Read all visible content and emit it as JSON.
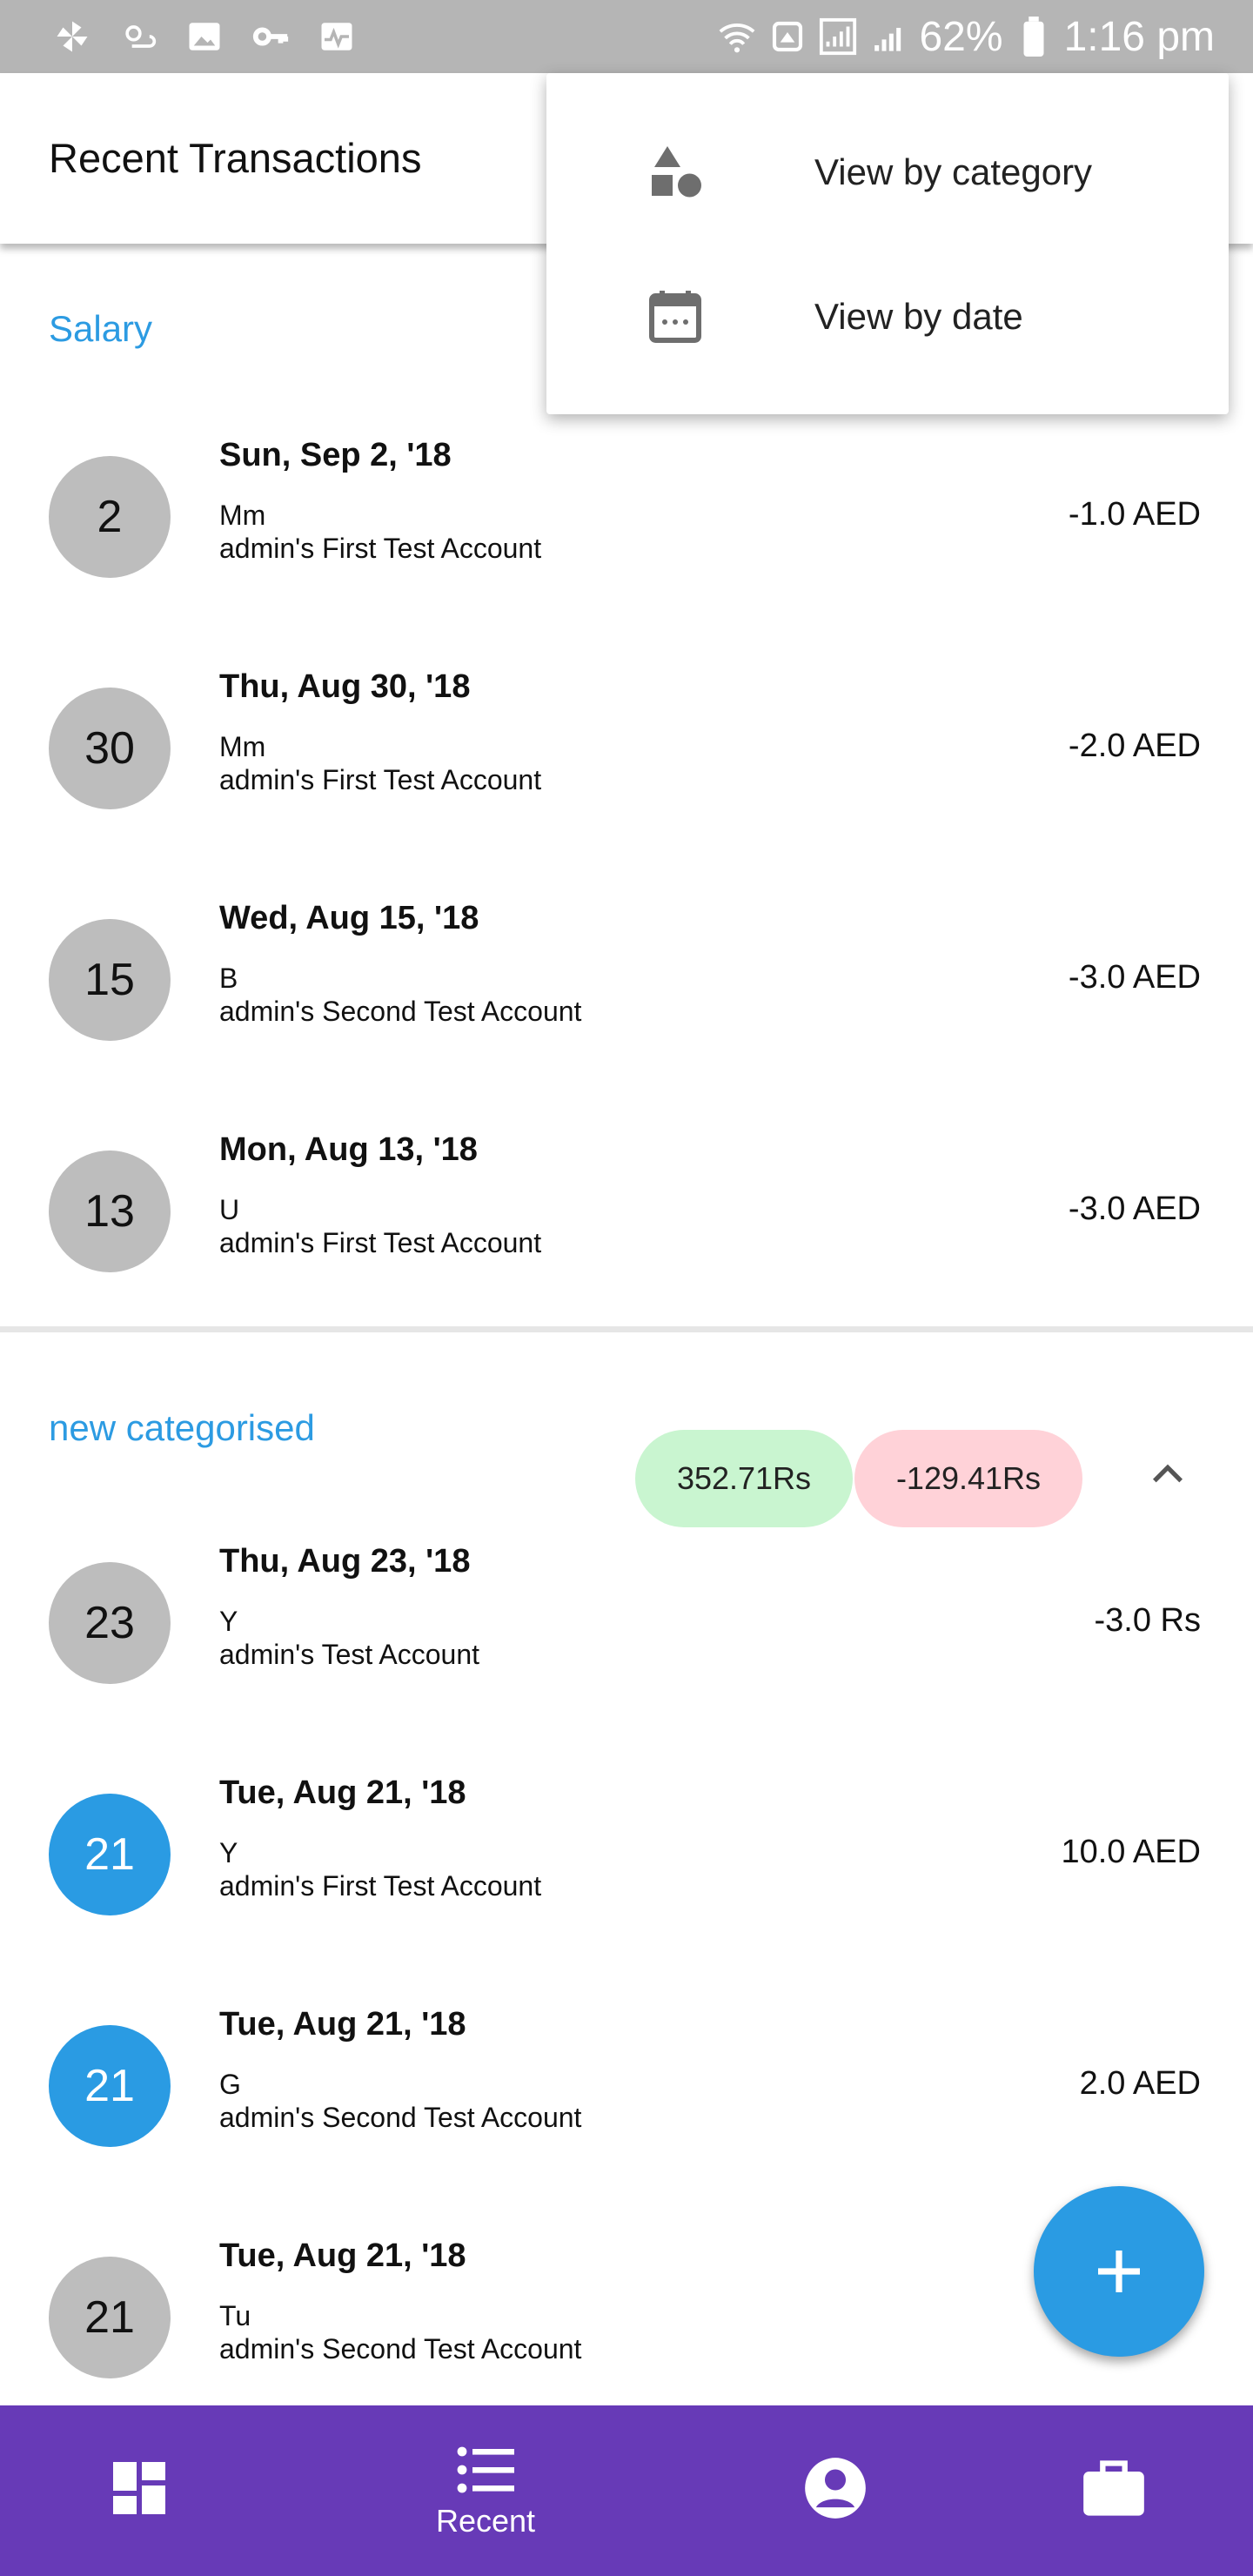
{
  "status_bar": {
    "battery": "62%",
    "time": "1:16 pm"
  },
  "app_bar": {
    "title": "Recent Transactions"
  },
  "menu": {
    "items": [
      {
        "label": "View by category",
        "icon": "category-shapes-icon"
      },
      {
        "label": "View by date",
        "icon": "calendar-icon"
      }
    ]
  },
  "groups": [
    {
      "title": "Salary",
      "transactions": [
        {
          "day": "2",
          "date": "Sun, Sep 2, '18",
          "desc": "Mm",
          "account": "admin's First Test Account",
          "amount": "-1.0 AED",
          "highlight": false
        },
        {
          "day": "30",
          "date": "Thu, Aug 30, '18",
          "desc": "Mm",
          "account": "admin's First Test Account",
          "amount": "-2.0 AED",
          "highlight": false
        },
        {
          "day": "15",
          "date": "Wed, Aug 15, '18",
          "desc": "B",
          "account": "admin's Second Test Account",
          "amount": "-3.0 AED",
          "highlight": false
        },
        {
          "day": "13",
          "date": "Mon, Aug 13, '18",
          "desc": "U",
          "account": "admin's First Test Account",
          "amount": "-3.0 AED",
          "highlight": false
        }
      ]
    },
    {
      "title": "new categorised",
      "income": "352.71Rs",
      "expense": "-129.41Rs",
      "transactions": [
        {
          "day": "23",
          "date": "Thu, Aug 23, '18",
          "desc": "Y",
          "account": "admin's Test Account",
          "amount": "-3.0 Rs",
          "highlight": false
        },
        {
          "day": "21",
          "date": "Tue, Aug 21, '18",
          "desc": "Y",
          "account": "admin's First Test Account",
          "amount": "10.0 AED",
          "highlight": true
        },
        {
          "day": "21",
          "date": "Tue, Aug 21, '18",
          "desc": "G",
          "account": "admin's Second Test Account",
          "amount": "2.0 AED",
          "highlight": true
        },
        {
          "day": "21",
          "date": "Tue, Aug 21, '18",
          "desc": "Tu",
          "account": "admin's Second Test Account",
          "amount": "",
          "highlight": false
        }
      ]
    }
  ],
  "bottom_nav": {
    "items": [
      {
        "label": "",
        "icon": "dashboard-icon"
      },
      {
        "label": "Recent",
        "icon": "list-icon"
      },
      {
        "label": "",
        "icon": "account-circle-icon"
      },
      {
        "label": "",
        "icon": "briefcase-icon"
      }
    ]
  },
  "colors": {
    "accent_blue": "#2a9be3",
    "nav_purple": "#673ab7",
    "income_pill": "#c9f5d0",
    "expense_pill": "#ffd2d8",
    "circle_grey": "#bdbdbd"
  }
}
